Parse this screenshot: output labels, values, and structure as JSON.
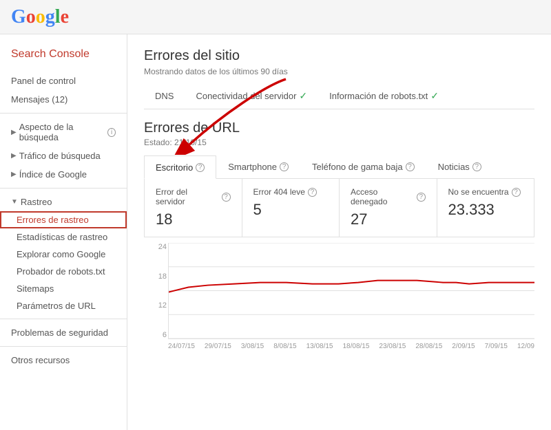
{
  "header": {
    "logo_letters": [
      "G",
      "o",
      "o",
      "g",
      "l",
      "e"
    ]
  },
  "sidebar": {
    "title": "Search Console",
    "items": [
      {
        "id": "panel-control",
        "label": "Panel de control",
        "type": "item"
      },
      {
        "id": "mensajes",
        "label": "Mensajes (12)",
        "type": "item"
      },
      {
        "id": "aspecto-busqueda",
        "label": "Aspecto de la búsqueda",
        "type": "section",
        "arrow": "▶",
        "has_info": true
      },
      {
        "id": "trafico-busqueda",
        "label": "Tráfico de búsqueda",
        "type": "section",
        "arrow": "▶"
      },
      {
        "id": "indice-google",
        "label": "Índice de Google",
        "type": "section",
        "arrow": "▶"
      },
      {
        "id": "rastreo",
        "label": "Rastreo",
        "type": "section-expanded",
        "arrow": "▼"
      },
      {
        "id": "errores-rastreo",
        "label": "Errores de rastreo",
        "type": "sub-item",
        "active": true
      },
      {
        "id": "estadisticas-rastreo",
        "label": "Estadísticas de rastreo",
        "type": "sub-item"
      },
      {
        "id": "explorar-google",
        "label": "Explorar como Google",
        "type": "sub-item"
      },
      {
        "id": "probador-robots",
        "label": "Probador de robots.txt",
        "type": "sub-item"
      },
      {
        "id": "sitemaps",
        "label": "Sitemaps",
        "type": "sub-item"
      },
      {
        "id": "parametros-url",
        "label": "Parámetros de URL",
        "type": "sub-item"
      },
      {
        "id": "problemas-seguridad",
        "label": "Problemas de seguridad",
        "type": "item"
      },
      {
        "id": "otros-recursos",
        "label": "Otros recursos",
        "type": "item"
      }
    ]
  },
  "main": {
    "site_errors": {
      "title": "Errores del sitio",
      "subtitle": "Mostrando datos de los últimos 90 días",
      "tabs": [
        {
          "id": "dns",
          "label": "DNS",
          "active": false,
          "has_check": false
        },
        {
          "id": "conectividad",
          "label": "Conectividad del servidor",
          "active": false,
          "has_check": true
        },
        {
          "id": "robots",
          "label": "Información de robots.txt",
          "active": false,
          "has_check": true
        }
      ]
    },
    "url_errors": {
      "title": "Errores de URL",
      "status": "Estado: 21/10/15",
      "tabs": [
        {
          "id": "escritorio",
          "label": "Escritorio",
          "active": true
        },
        {
          "id": "smartphone",
          "label": "Smartphone",
          "active": false
        },
        {
          "id": "telefono-gama-baja",
          "label": "Teléfono de gama baja",
          "active": false
        },
        {
          "id": "noticias",
          "label": "Noticias",
          "active": false
        }
      ],
      "stats": [
        {
          "id": "error-servidor",
          "label": "Error del servidor",
          "value": "18",
          "has_info": true
        },
        {
          "id": "error-404",
          "label": "Error 404 leve",
          "value": "5",
          "has_info": true
        },
        {
          "id": "acceso-denegado",
          "label": "Acceso denegado",
          "value": "27",
          "has_info": true
        },
        {
          "id": "no-encuentra",
          "label": "No se encuentra",
          "value": "23.333",
          "has_info": true
        }
      ]
    },
    "chart": {
      "y_labels": [
        "24",
        "18",
        "12",
        "6",
        ""
      ],
      "x_labels": [
        "24/07/15",
        "29/07/15",
        "3/08/15",
        "8/08/15",
        "13/08/15",
        "18/08/15",
        "23/08/15",
        "28/08/15",
        "2/09/15",
        "7/09/15",
        "12/09"
      ]
    }
  }
}
